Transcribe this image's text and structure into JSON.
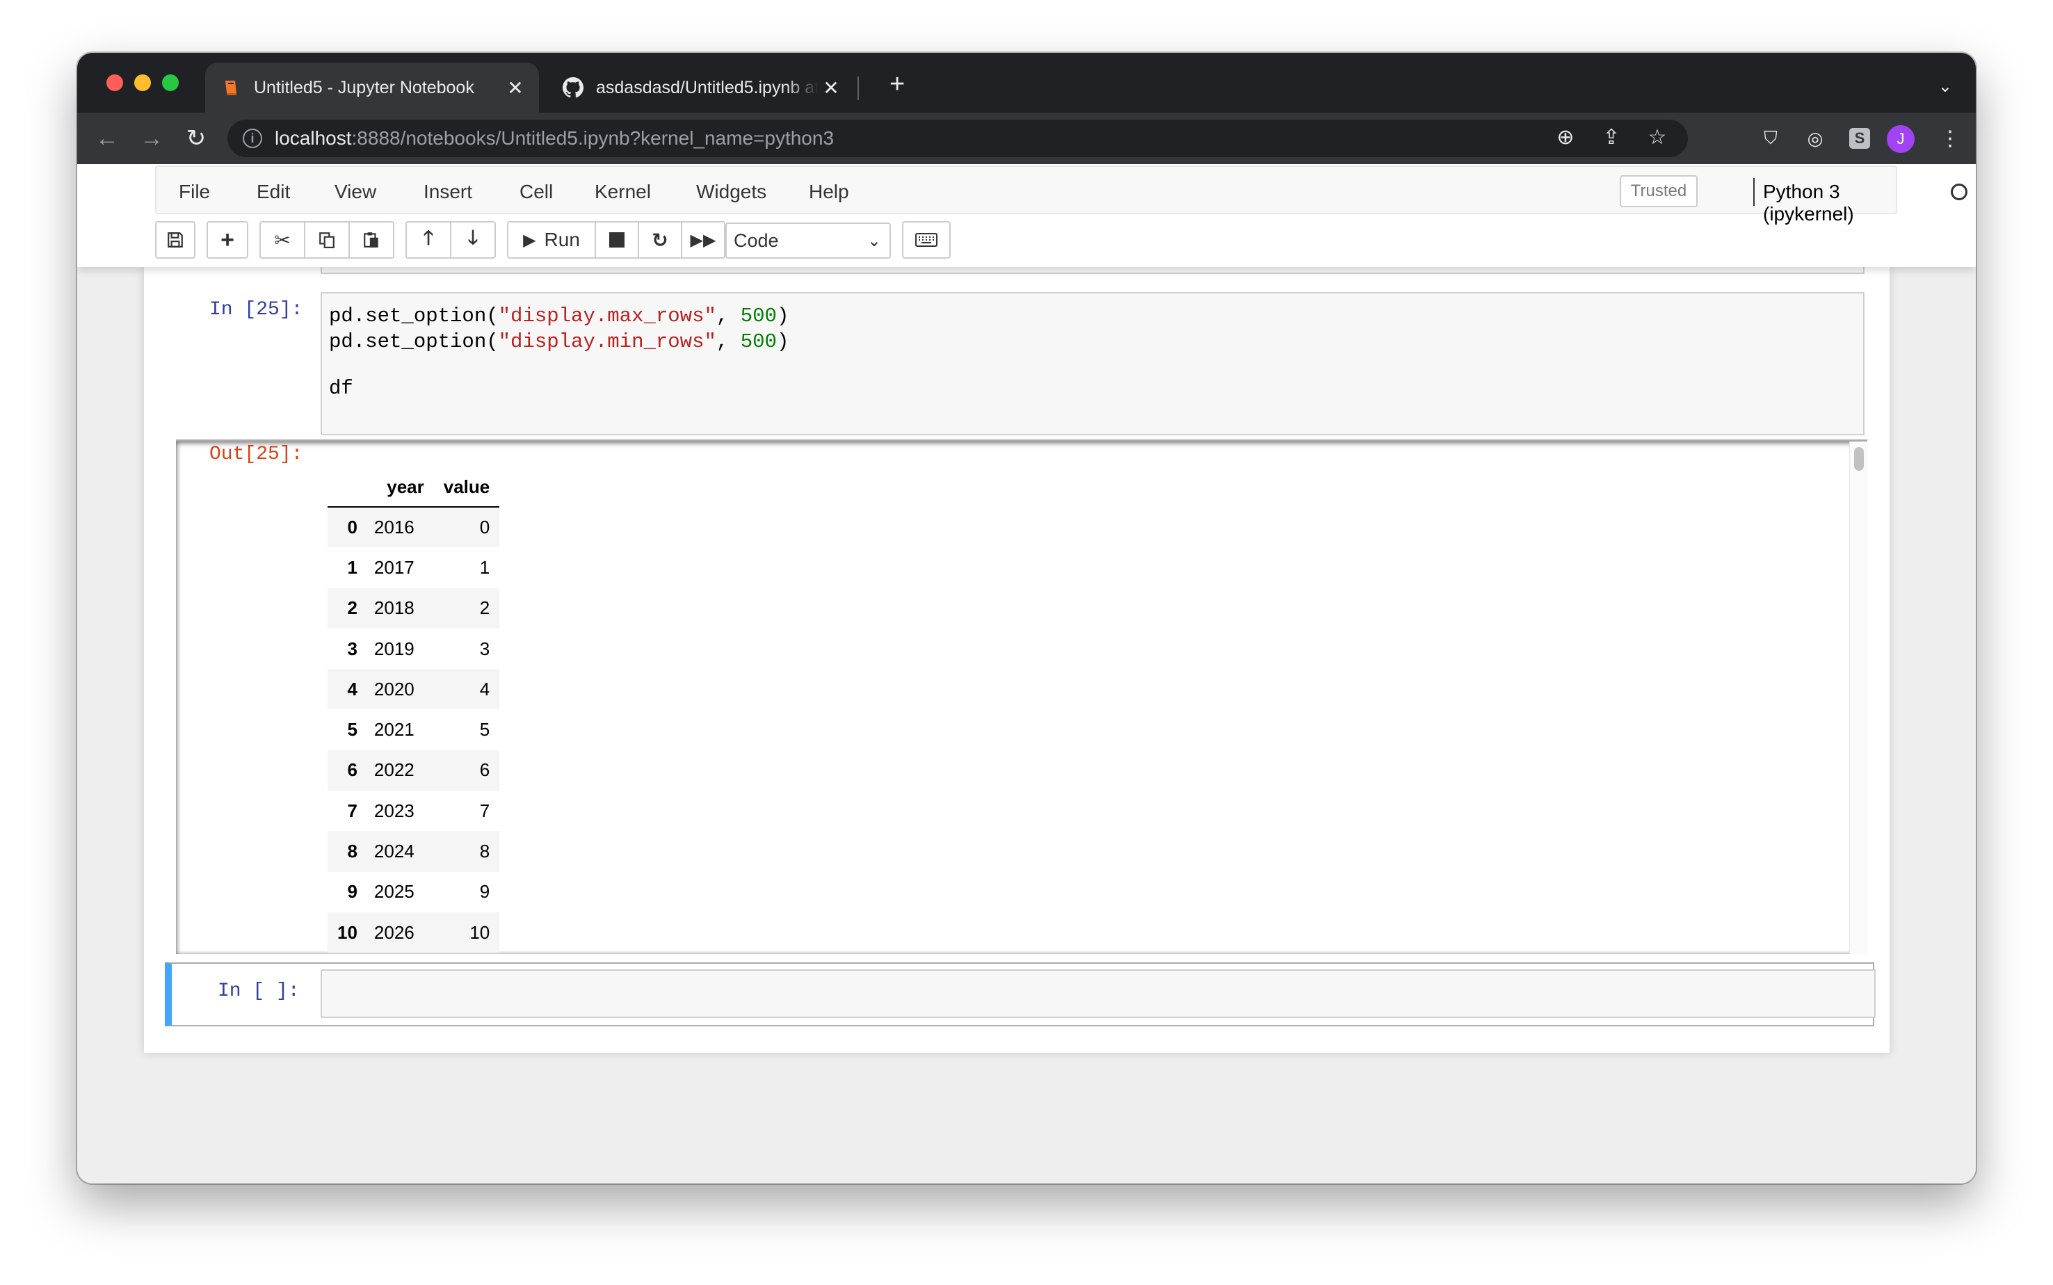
{
  "browser": {
    "tabs": [
      {
        "label": "Untitled5 - Jupyter Notebook",
        "active": true,
        "icon": "jupyter-book-icon"
      },
      {
        "label": "asdasdasd/Untitled5.ipynb at ma",
        "active": false,
        "icon": "github-icon"
      }
    ],
    "url": {
      "host": "localhost",
      "path": ":8888/notebooks/Untitled5.ipynb?kernel_name=python3"
    },
    "profile_initial": "J",
    "accent": "#a142f4"
  },
  "menubar": {
    "items": [
      "File",
      "Edit",
      "View",
      "Insert",
      "Cell",
      "Kernel",
      "Widgets",
      "Help"
    ],
    "trusted": "Trusted",
    "kernel": "Python 3 (ipykernel)"
  },
  "toolbar": {
    "run_label": "Run",
    "cell_type": "Code"
  },
  "cells": {
    "cell1": {
      "prompt": "In [25]:",
      "code": [
        [
          {
            "t": "pd.set_option(",
            "c": ""
          },
          {
            "t": "\"display.max_rows\"",
            "c": "str"
          },
          {
            "t": ", ",
            "c": ""
          },
          {
            "t": "500",
            "c": "num"
          },
          {
            "t": ")",
            "c": ""
          }
        ],
        [
          {
            "t": "pd.set_option(",
            "c": ""
          },
          {
            "t": "\"display.min_rows\"",
            "c": "str"
          },
          {
            "t": ", ",
            "c": ""
          },
          {
            "t": "500",
            "c": "num"
          },
          {
            "t": ")",
            "c": ""
          }
        ],
        [],
        [
          {
            "t": "df",
            "c": ""
          }
        ]
      ],
      "out_prompt": "Out[25]:",
      "table": {
        "columns": [
          "year",
          "value"
        ],
        "rows": [
          [
            "0",
            "2016",
            "0"
          ],
          [
            "1",
            "2017",
            "1"
          ],
          [
            "2",
            "2018",
            "2"
          ],
          [
            "3",
            "2019",
            "3"
          ],
          [
            "4",
            "2020",
            "4"
          ],
          [
            "5",
            "2021",
            "5"
          ],
          [
            "6",
            "2022",
            "6"
          ],
          [
            "7",
            "2023",
            "7"
          ],
          [
            "8",
            "2024",
            "8"
          ],
          [
            "9",
            "2025",
            "9"
          ],
          [
            "10",
            "2026",
            "10"
          ]
        ]
      }
    },
    "cell2": {
      "prompt": "In [ ]:"
    }
  }
}
